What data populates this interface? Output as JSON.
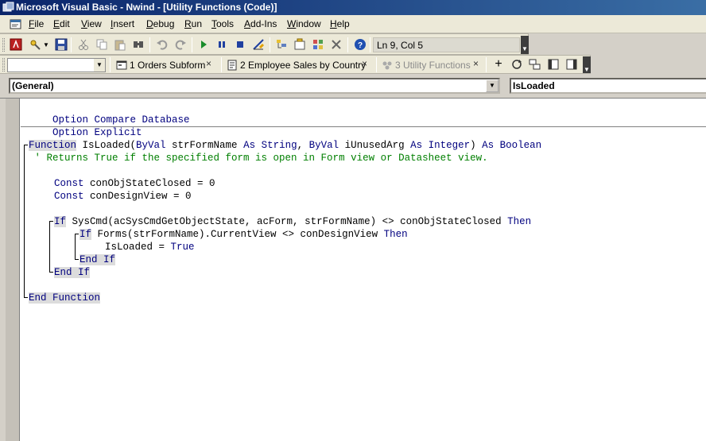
{
  "window": {
    "title": "Microsoft Visual Basic - Nwind - [Utility Functions (Code)]"
  },
  "menu": [
    {
      "label": "File",
      "acc": "F",
      "rest": "ile"
    },
    {
      "label": "Edit",
      "acc": "E",
      "rest": "dit"
    },
    {
      "label": "View",
      "acc": "V",
      "rest": "iew"
    },
    {
      "label": "Insert",
      "acc": "I",
      "rest": "nsert"
    },
    {
      "label": "Debug",
      "acc": "D",
      "rest": "ebug"
    },
    {
      "label": "Run",
      "acc": "R",
      "rest": "un"
    },
    {
      "label": "Tools",
      "acc": "T",
      "rest": "ools"
    },
    {
      "label": "Add-Ins",
      "acc": "A",
      "rest": "dd-Ins"
    },
    {
      "label": "Window",
      "acc": "W",
      "rest": "indow"
    },
    {
      "label": "Help",
      "acc": "H",
      "rest": "elp"
    }
  ],
  "toolbar": {
    "position_label": "Ln 9, Col 5",
    "icons": [
      "access-view-icon",
      "insert-module-icon",
      "save-icon",
      "cut-icon",
      "copy-icon",
      "paste-icon",
      "find-icon",
      "undo-icon",
      "redo-icon",
      "run-icon",
      "break-icon",
      "reset-icon",
      "design-mode-icon",
      "project-explorer-icon",
      "properties-icon",
      "object-browser-icon",
      "toolbox-icon",
      "help-icon"
    ]
  },
  "tabs": [
    {
      "number": "1",
      "label": "1 Orders Subform",
      "active": true
    },
    {
      "number": "2",
      "label": "2 Employee Sales by Country",
      "active": true
    },
    {
      "number": "3",
      "label": "3 Utility Functions",
      "active": false
    }
  ],
  "code_window": {
    "object_combo": "(General)",
    "procedure_combo": "IsLoaded"
  },
  "code": {
    "l1": [
      {
        "t": "Option Compare Database",
        "c": "kw"
      }
    ],
    "l2": [
      {
        "t": "Option Explicit",
        "c": "kw"
      }
    ],
    "l3_a": "Function",
    "l3_b": " IsLoaded(",
    "l3_c": "ByVal",
    "l3_d": " strFormName ",
    "l3_e": "As String",
    "l3_f": ", ",
    "l3_g": "ByVal",
    "l3_h": " iUnusedArg ",
    "l3_i": "As Integer",
    "l3_j": ") ",
    "l3_k": "As Boolean",
    "l4": " ' Returns True if the specified form is open in Form view or Datasheet view.",
    "l5_a": "Const",
    "l5_b": " conObjStateClosed = 0",
    "l6_a": "Const",
    "l6_b": " conDesignView = 0",
    "l7_a": "If",
    "l7_b": " SysCmd(acSysCmdGetObjectState, acForm, strFormName) <> conObjStateClosed ",
    "l7_c": "Then",
    "l8_a": "If",
    "l8_b": " Forms(strFormName).CurrentView <> conDesignView ",
    "l8_c": "Then",
    "l9_a": "IsLoaded = ",
    "l9_b": "True",
    "l10": "End If",
    "l11": "End If",
    "l12": "End Function"
  }
}
